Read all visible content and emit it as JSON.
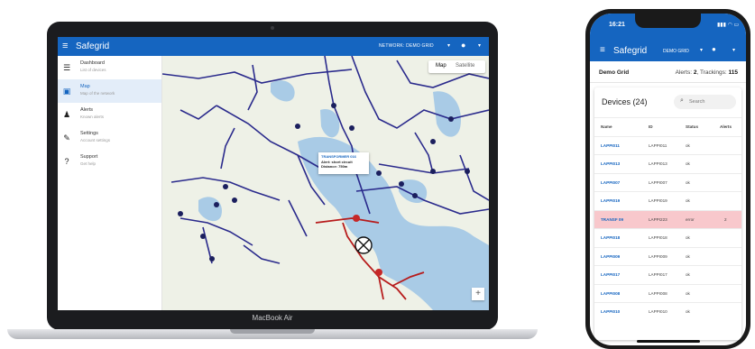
{
  "laptop": {
    "brand": "MacBook Air",
    "app": {
      "title": "Safegrid",
      "network_label": "NETWORK: DEMO GRID",
      "sidebar": [
        {
          "label": "Dashboard",
          "sub": "List of devices",
          "icon": "list-icon",
          "active": false
        },
        {
          "label": "Map",
          "sub": "Map of the network",
          "icon": "map-icon",
          "active": true
        },
        {
          "label": "Alerts",
          "sub": "Known alerts",
          "icon": "bell-icon",
          "active": false
        },
        {
          "label": "Settings",
          "sub": "Account settings",
          "icon": "wrench-icon",
          "active": false
        },
        {
          "label": "Support",
          "sub": "Get help",
          "icon": "help-icon",
          "active": false
        }
      ],
      "map": {
        "toggle": {
          "map": "Map",
          "satellite": "Satellite"
        },
        "zoom_in": "+",
        "popup": {
          "title": "TRANSFORMER 016",
          "alert": "Alert: short circuit",
          "distance": "Distance: 750m"
        },
        "colors": {
          "network_line": "#2a2a8c",
          "fault_line": "#b71c1c",
          "water": "#a9cbe6",
          "land": "#eef1e7"
        }
      }
    }
  },
  "phone": {
    "time": "16:21",
    "app_title": "Safegrid",
    "network_label": "DEMO GRID",
    "grid_name": "Demo Grid",
    "alerts_label": "Alerts:",
    "alerts_count": "2",
    "trackings_label": "Trackings:",
    "trackings_count": "115",
    "devices_title": "Devices (24)",
    "search_placeholder": "Search",
    "columns": {
      "name": "Name",
      "id": "ID",
      "status": "Status",
      "alerts": "Alerts"
    },
    "rows": [
      {
        "name": "LAPPI011",
        "id": "LAPPI011",
        "status": "ok",
        "alerts": ""
      },
      {
        "name": "LAPPI013",
        "id": "LAPPI013",
        "status": "ok",
        "alerts": ""
      },
      {
        "name": "LAPPI007",
        "id": "LAPPI007",
        "status": "ok",
        "alerts": ""
      },
      {
        "name": "LAPPI019",
        "id": "LAPPI019",
        "status": "ok",
        "alerts": ""
      },
      {
        "name": "TRANSF 09",
        "id": "LAPPI223",
        "status": "error",
        "alerts": "2"
      },
      {
        "name": "LAPPI018",
        "id": "LAPPI018",
        "status": "ok",
        "alerts": ""
      },
      {
        "name": "LAPPI009",
        "id": "LAPPI009",
        "status": "ok",
        "alerts": ""
      },
      {
        "name": "LAPPI017",
        "id": "LAPPI017",
        "status": "ok",
        "alerts": ""
      },
      {
        "name": "LAPPI008",
        "id": "LAPPI008",
        "status": "ok",
        "alerts": ""
      },
      {
        "name": "LAPPI010",
        "id": "LAPPI010",
        "status": "ok",
        "alerts": ""
      }
    ]
  }
}
